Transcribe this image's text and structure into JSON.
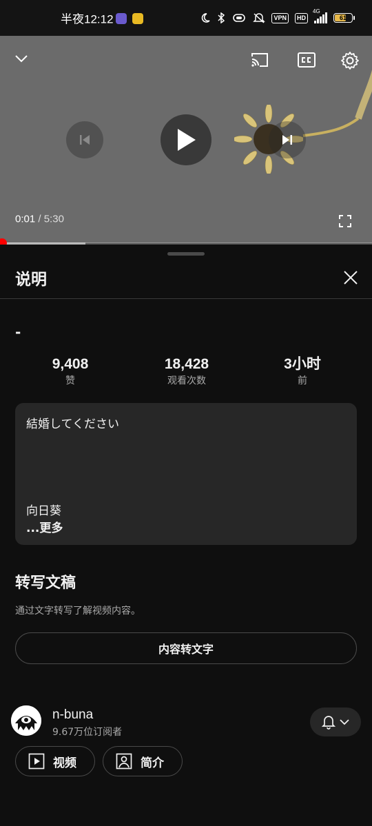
{
  "status_bar": {
    "time": "半夜12:12",
    "vpn_label": "VPN",
    "hd_label": "HD",
    "network_label": "4G",
    "battery_level": "61",
    "app_icon_colors": [
      "#6a5acd",
      "#e8b923"
    ]
  },
  "player": {
    "current_time": "0:01",
    "separator": " / ",
    "total_time": "5:30",
    "played_fraction": 0.003,
    "buffered_fraction": 0.23,
    "icons": {
      "collapse": "chevron-down-icon",
      "cast": "cast-icon",
      "captions": "closed-captions-icon",
      "settings": "gear-icon",
      "previous": "skip-previous-icon",
      "play": "play-icon",
      "next": "skip-next-icon",
      "fullscreen": "fullscreen-icon"
    }
  },
  "description_panel": {
    "title": "说明",
    "video_title": "-",
    "stats": [
      {
        "value": "9,408",
        "label": "赞"
      },
      {
        "value": "18,428",
        "label": "观看次数"
      },
      {
        "value": "3小时",
        "label": "前"
      }
    ],
    "description_lines": [
      "結婚してください",
      "向日葵"
    ],
    "more_label": "...更多"
  },
  "transcript": {
    "title": "转写文稿",
    "subtitle": "通过文字转写了解视频内容。",
    "button_label": "内容转文字"
  },
  "channel": {
    "name": "n-buna",
    "subscribers": "9.67万位订阅者",
    "videos_label": "视频",
    "about_label": "简介"
  },
  "colors": {
    "background": "#0f0f0f",
    "card": "#272727",
    "accent_red": "#ff0000",
    "player_gray": "#6b6b6b"
  }
}
